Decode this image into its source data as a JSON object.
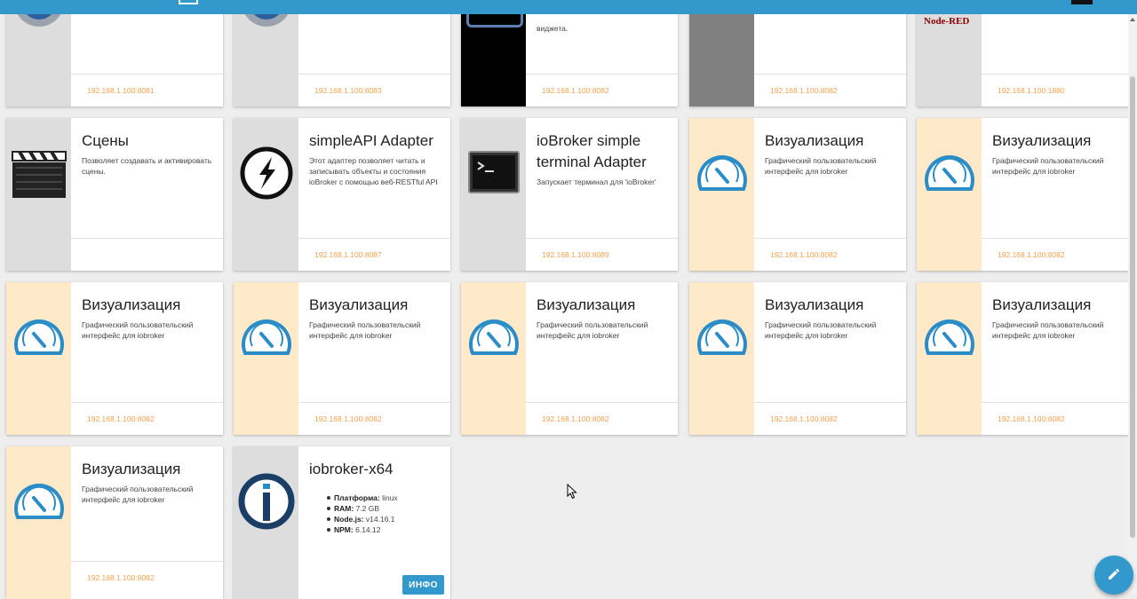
{
  "top_row": [
    {
      "link": "192.168.1.100:8081",
      "side": "grey",
      "icon": "gear-icon"
    },
    {
      "link": "192.168.1.100:8083",
      "side": "grey",
      "icon": "gear-icon"
    },
    {
      "link": "192.168.1.100:8082",
      "side": "black",
      "icon": "widget-screen-icon",
      "desc": "виджета."
    },
    {
      "link": "192.168.1.100:8082",
      "side": "darkgrey",
      "icon": "none"
    },
    {
      "link": "192.168.1.100:1880",
      "side": "grey",
      "icon": "node-red-logo",
      "logo_text": "Node-RED"
    }
  ],
  "cards": [
    {
      "title": "Сцены",
      "desc": "Позволяет создавать и активировать сцены.",
      "link": "",
      "icon": "clapperboard-icon",
      "side": "grey"
    },
    {
      "title": "simpleAPI Adapter",
      "desc": "Этот адаптер позволяет читать и записывать объекты и состояния ioBroker с помощью веб-RESTful API",
      "link": "192.168.1.100:8087",
      "icon": "lightning-icon",
      "side": "grey"
    },
    {
      "title": "ioBroker simple terminal Adapter",
      "desc": "Запускает терминал для 'ioBroker'",
      "link": "192.168.1.100:8089",
      "icon": "terminal-icon",
      "side": "grey"
    },
    {
      "title": "Визуализация",
      "desc": "Графический пользовательский интерфейс для iobroker",
      "link": "192.168.1.100:8082",
      "icon": "gauge-icon",
      "side": "orange"
    },
    {
      "title": "Визуализация",
      "desc": "Графический пользовательский интерфейс для iobroker",
      "link": "192.168.1.100:8082",
      "icon": "gauge-icon",
      "side": "orange"
    },
    {
      "title": "Визуализация",
      "desc": "Графический пользовательский интерфейс для iobroker",
      "link": "192.168.1.100:8082",
      "icon": "gauge-icon",
      "side": "orange"
    },
    {
      "title": "Визуализация",
      "desc": "Графический пользовательский интерфейс для iobroker",
      "link": "192.168.1.100:8082",
      "icon": "gauge-icon",
      "side": "orange"
    },
    {
      "title": "Визуализация",
      "desc": "Графический пользовательский интерфейс для iobroker",
      "link": "192.168.1.100:8082",
      "icon": "gauge-icon",
      "side": "orange"
    },
    {
      "title": "Визуализация",
      "desc": "Графический пользовательский интерфейс для iobroker",
      "link": "192.168.1.100:8082",
      "icon": "gauge-icon",
      "side": "orange"
    },
    {
      "title": "Визуализация",
      "desc": "Графический пользовательский интерфейс для iobroker",
      "link": "192.168.1.100:8082",
      "icon": "gauge-icon",
      "side": "orange"
    },
    {
      "title": "Визуализация",
      "desc": "Графический пользовательский интерфейс для iobroker",
      "link": "192.168.1.100:8082",
      "icon": "gauge-icon",
      "side": "orange"
    }
  ],
  "host": {
    "title": "iobroker-x64",
    "platform_label": "Платформа:",
    "platform": "linux",
    "ram_label": "RAM:",
    "ram": "7.2 GB",
    "node_label": "Node.js:",
    "node": "v14.16.1",
    "npm_label": "NPM:",
    "npm": "6.14.12",
    "info_button": "ИНФО"
  },
  "colors": {
    "accent": "#3399cc",
    "link": "#f5a04a",
    "orange_side": "#fde8c8"
  },
  "fab_icon": "pencil-icon"
}
